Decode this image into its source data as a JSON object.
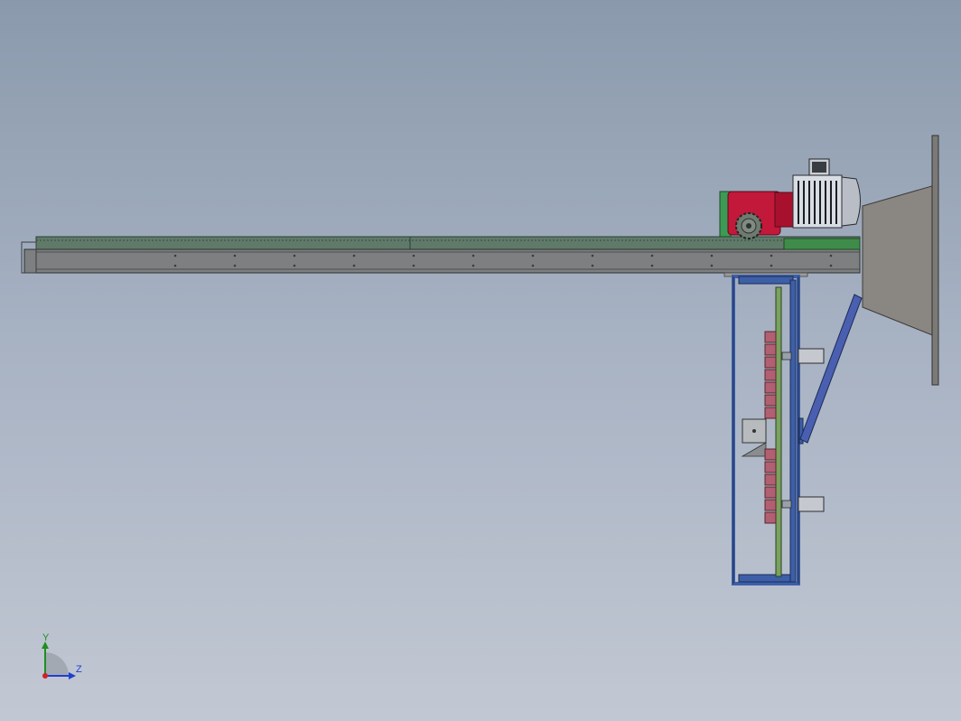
{
  "viewport": {
    "background_top": "#8a9aac",
    "background_bottom": "#c2c8d3"
  },
  "model": {
    "parts": [
      "rack-beam",
      "gear-motor",
      "sprocket",
      "mounting-plate",
      "hopper",
      "vertical-frame",
      "diagonal-brace",
      "guide-blocks",
      "shaft-couplings"
    ],
    "colors": {
      "beam": "#7d7f80",
      "rack": "#5f7a68",
      "motor_body": "#d8dde4",
      "gearbox": "#c2183a",
      "frame": "#3d5fa8",
      "hopper": "#8a8782",
      "blocks": "#b06070"
    }
  },
  "triad": {
    "y_label": "Y",
    "z_label": "Z",
    "icon": "coordinate-triad-icon"
  }
}
